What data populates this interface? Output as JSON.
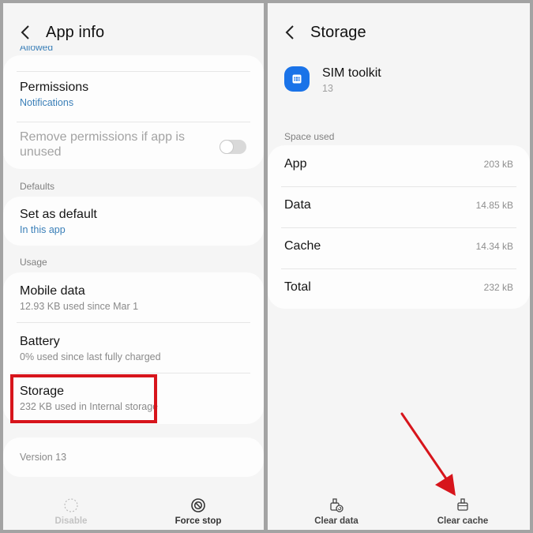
{
  "left_screen": {
    "header": {
      "title": "App info",
      "back_icon": "chevron-left-icon"
    },
    "cut_off_text": "Allowed",
    "permissions": {
      "title": "Permissions",
      "subtitle": "Notifications"
    },
    "remove_permissions": {
      "title_line1": "Remove permissions if app is",
      "title_line2": "unused",
      "toggle_on": false
    },
    "sections": {
      "defaults": "Defaults",
      "usage": "Usage"
    },
    "set_as_default": {
      "title": "Set as default",
      "subtitle": "In this app"
    },
    "mobile_data": {
      "title": "Mobile data",
      "subtitle": "12.93 KB used since Mar 1"
    },
    "battery": {
      "title": "Battery",
      "subtitle": "0% used since last fully charged"
    },
    "storage": {
      "title": "Storage",
      "subtitle": "232 KB used in Internal storage",
      "highlighted": true
    },
    "version": "Version 13",
    "bottom_bar": {
      "disable": {
        "label": "Disable",
        "icon": "dashed-circle-icon",
        "enabled": false
      },
      "force_stop": {
        "label": "Force stop",
        "icon": "stop-sign-icon",
        "enabled": true
      }
    }
  },
  "right_screen": {
    "header": {
      "title": "Storage",
      "back_icon": "chevron-left-icon"
    },
    "app": {
      "name": "SIM toolkit",
      "version": "13",
      "icon": "sim-card-icon",
      "icon_color": "#1a73e8"
    },
    "section": "Space used",
    "rows": [
      {
        "label": "App",
        "value": "203 kB"
      },
      {
        "label": "Data",
        "value": "14.85 kB"
      },
      {
        "label": "Cache",
        "value": "14.34 kB"
      },
      {
        "label": "Total",
        "value": "232 kB"
      }
    ],
    "bottom_bar": {
      "clear_data": {
        "label": "Clear data",
        "icon": "clear-data-brush-icon"
      },
      "clear_cache": {
        "label": "Clear cache",
        "icon": "clear-cache-brush-icon"
      }
    }
  },
  "annotations": {
    "highlight_color": "#d7151c",
    "arrow_color": "#d7151c"
  }
}
